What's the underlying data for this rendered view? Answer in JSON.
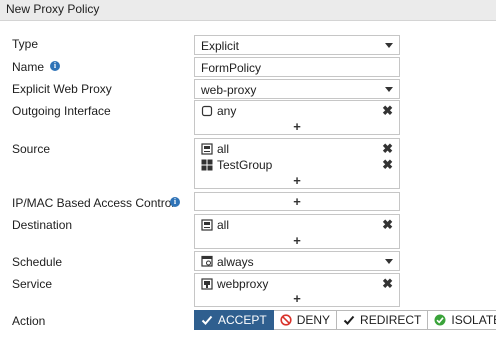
{
  "window": {
    "title": "New Proxy Policy"
  },
  "labels": {
    "type": "Type",
    "name": "Name",
    "explicit_web_proxy": "Explicit Web Proxy",
    "outgoing_interface": "Outgoing Interface",
    "source": "Source",
    "ipmac": "IP/MAC Based Access Control",
    "destination": "Destination",
    "schedule": "Schedule",
    "service": "Service",
    "action": "Action"
  },
  "fields": {
    "type": {
      "value": "Explicit"
    },
    "name": {
      "value": "FormPolicy"
    },
    "explicit_web_proxy": {
      "value": "web-proxy"
    },
    "outgoing_interface": {
      "items": [
        "any"
      ]
    },
    "source": {
      "items": [
        "all",
        "TestGroup"
      ]
    },
    "destination": {
      "items": [
        "all"
      ]
    },
    "schedule": {
      "value": "always"
    },
    "service": {
      "items": [
        "webproxy"
      ]
    }
  },
  "glyphs": {
    "plus": "+",
    "remove": "✖",
    "info": "i"
  },
  "action_buttons": [
    {
      "label": "ACCEPT",
      "icon": "check-icon",
      "active": true
    },
    {
      "label": "DENY",
      "icon": "deny-icon",
      "active": false
    },
    {
      "label": "REDIRECT",
      "icon": "check-icon",
      "active": false
    },
    {
      "label": "ISOLATE",
      "icon": "check-circle-icon",
      "active": false
    }
  ],
  "colors": {
    "accent": "#2f5f8f",
    "info": "#2f73b7",
    "deny": "#d9342b",
    "isolate": "#3aa33a"
  }
}
